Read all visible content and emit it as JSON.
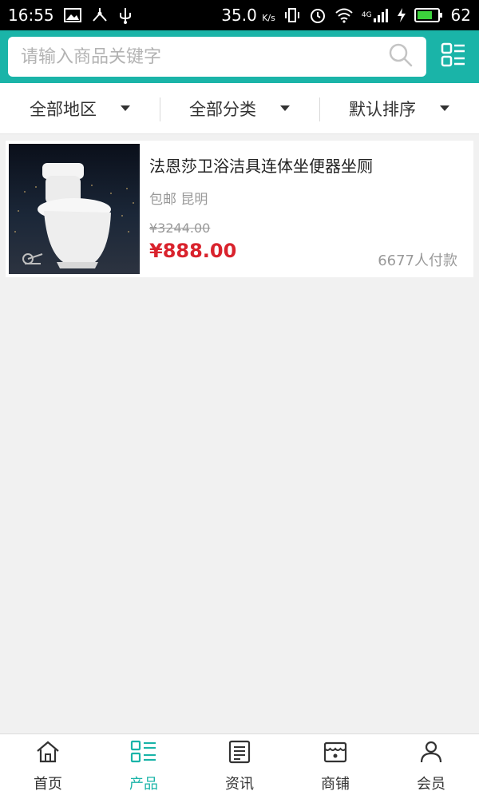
{
  "status_bar": {
    "time": "16:55",
    "speed": "35.0",
    "speed_unit": "K/s",
    "network": "4G",
    "battery": "62"
  },
  "search": {
    "placeholder": "请输入商品关键字"
  },
  "filters": [
    {
      "label": "全部地区"
    },
    {
      "label": "全部分类"
    },
    {
      "label": "默认排序"
    }
  ],
  "product": {
    "title": "法恩莎卫浴洁具连体坐便器坐厕",
    "shipping": "包邮",
    "location": "昆明",
    "original_price": "¥3244.00",
    "price": "¥888.00",
    "sold": "6677人付款"
  },
  "nav": [
    {
      "label": "首页",
      "icon": "home-icon"
    },
    {
      "label": "产品",
      "icon": "product-list-icon",
      "active": true
    },
    {
      "label": "资讯",
      "icon": "news-icon"
    },
    {
      "label": "商铺",
      "icon": "shop-icon"
    },
    {
      "label": "会员",
      "icon": "member-icon"
    }
  ],
  "colors": {
    "accent": "#1ab4a8",
    "price": "#d9232d",
    "background": "#f1f1f1"
  }
}
